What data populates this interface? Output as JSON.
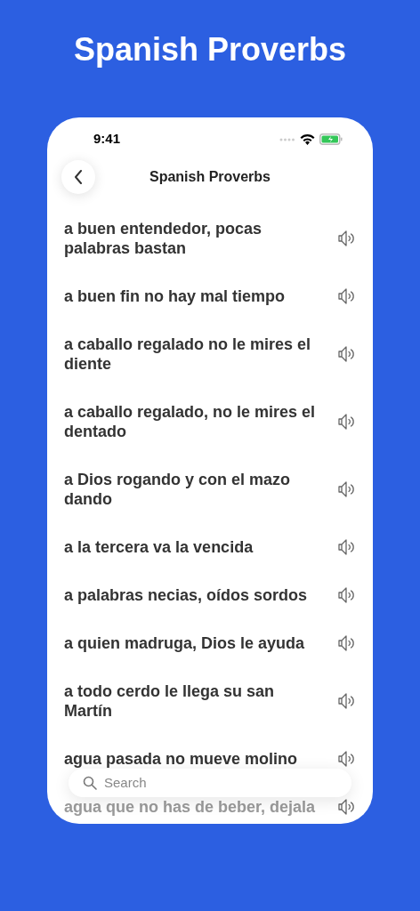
{
  "page_title": "Spanish Proverbs",
  "status_bar": {
    "time": "9:41"
  },
  "header": {
    "title": "Spanish Proverbs"
  },
  "proverbs": [
    {
      "text": "a buen entendedor, pocas palabras bastan"
    },
    {
      "text": "a buen fin no hay mal tiempo"
    },
    {
      "text": "a caballo regalado no le mires el diente"
    },
    {
      "text": "a caballo regalado, no le mires el dentado"
    },
    {
      "text": "a Dios rogando y con el mazo dando"
    },
    {
      "text": "a la tercera va la vencida"
    },
    {
      "text": "a palabras necias, oídos sordos"
    },
    {
      "text": "a quien madruga, Dios le ayuda"
    },
    {
      "text": "a todo cerdo le llega su san Martín"
    },
    {
      "text": "agua pasada no mueve molino"
    },
    {
      "text": "agua que no has de beber, dejala"
    }
  ],
  "search": {
    "placeholder": "Search"
  }
}
